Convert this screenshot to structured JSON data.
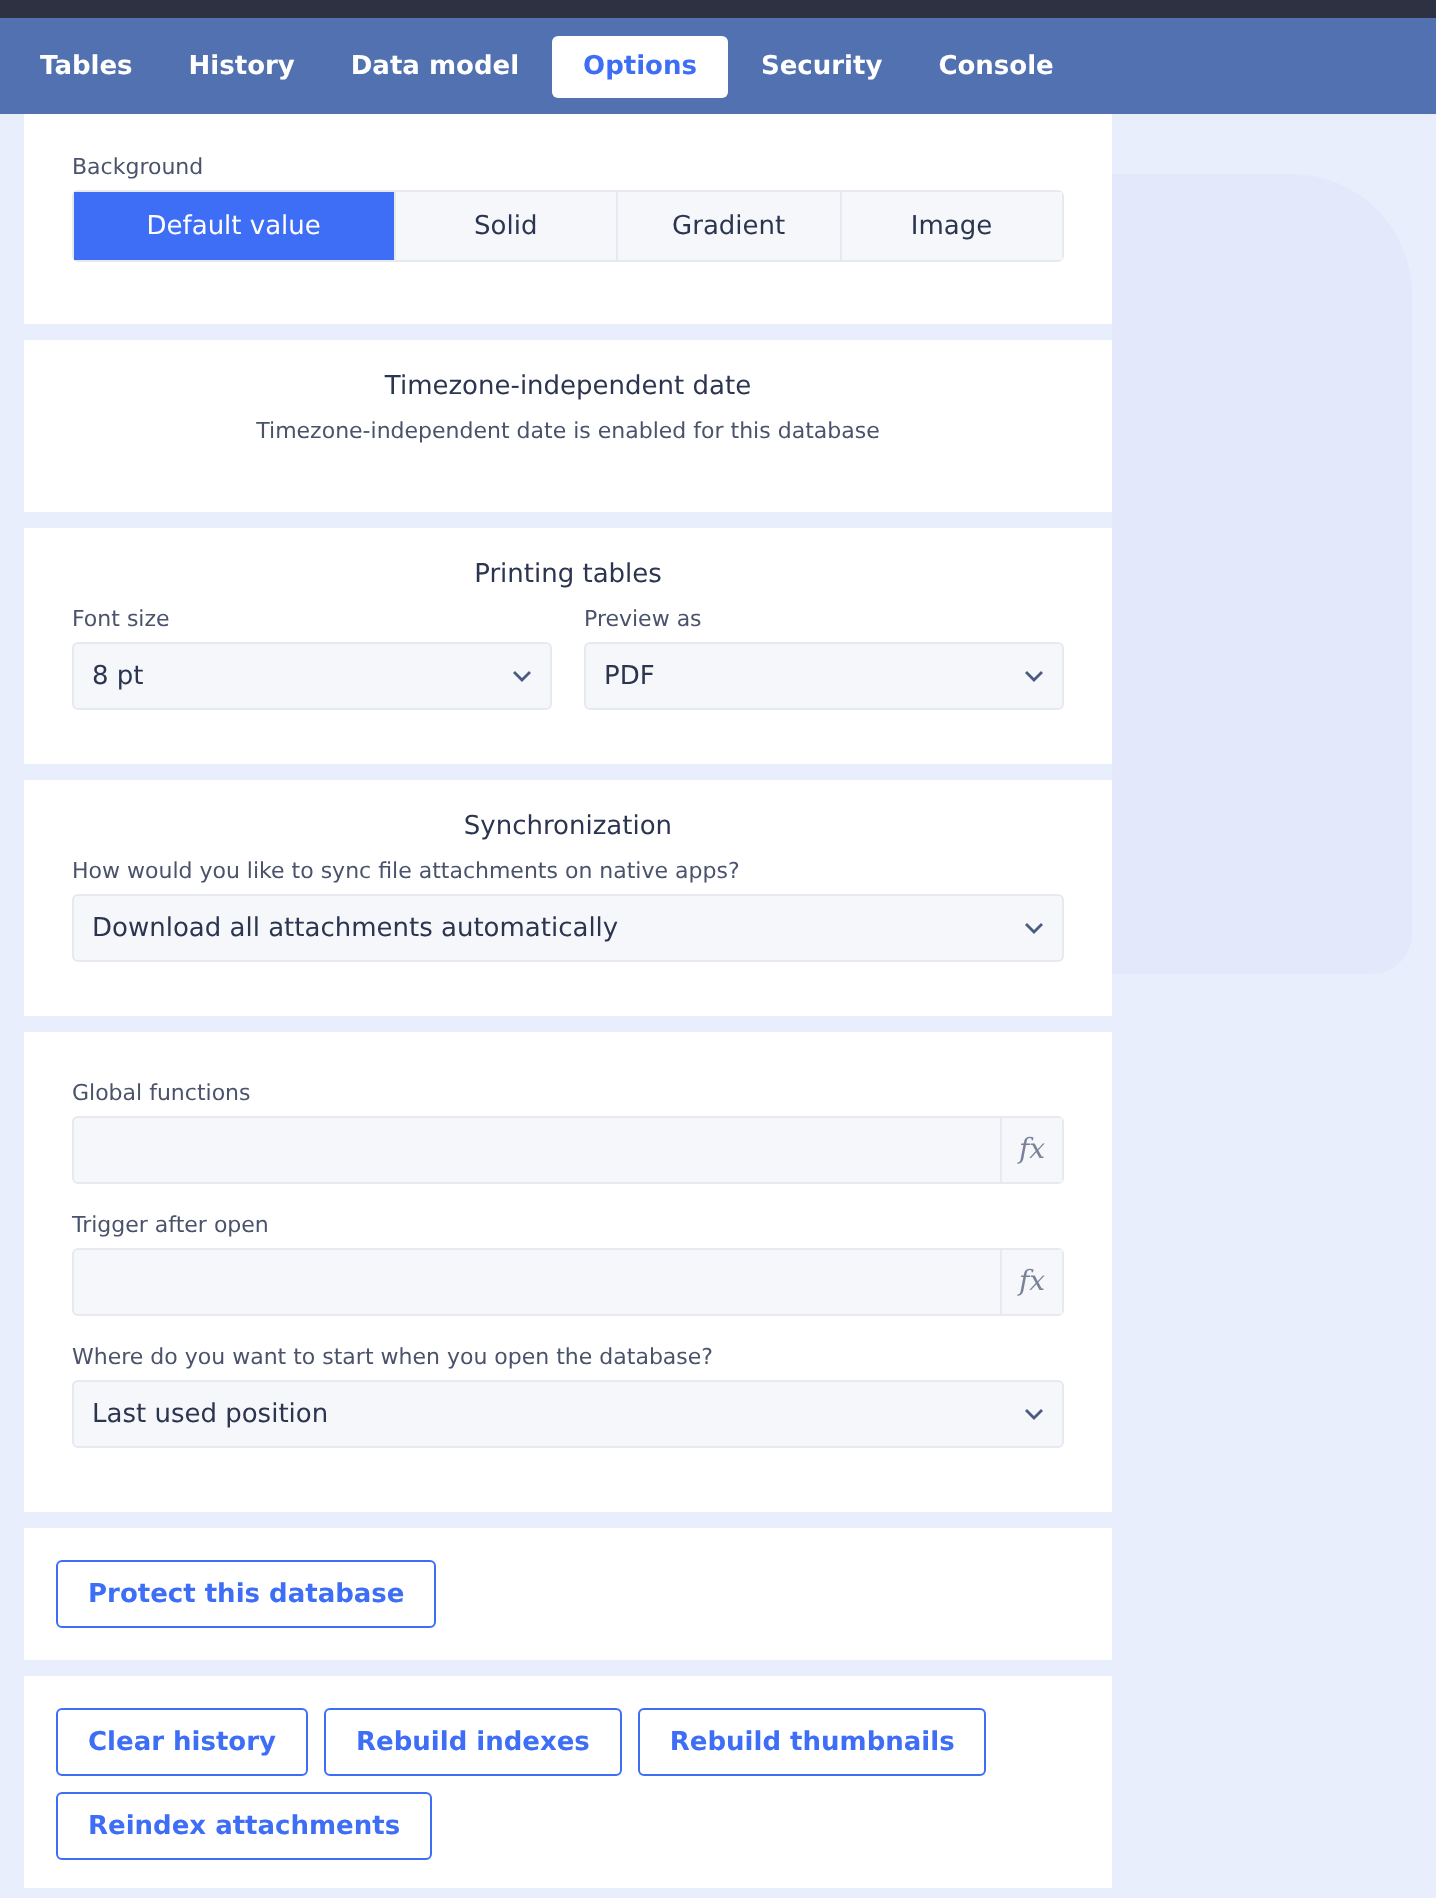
{
  "tabs": [
    {
      "label": "Tables",
      "selected": false
    },
    {
      "label": "History",
      "selected": false
    },
    {
      "label": "Data model",
      "selected": false
    },
    {
      "label": "Options",
      "selected": true
    },
    {
      "label": "Security",
      "selected": false
    },
    {
      "label": "Console",
      "selected": false
    }
  ],
  "background": {
    "label": "Background",
    "options": [
      {
        "label": "Default value",
        "selected": true
      },
      {
        "label": "Solid",
        "selected": false
      },
      {
        "label": "Gradient",
        "selected": false
      },
      {
        "label": "Image",
        "selected": false
      }
    ]
  },
  "timezone": {
    "title": "Timezone-independent date",
    "text": "Timezone-independent date is enabled for this database"
  },
  "printing": {
    "title": "Printing tables",
    "fields": [
      {
        "label": "Font size",
        "value": "8 pt"
      },
      {
        "label": "Preview as",
        "value": "PDF"
      }
    ]
  },
  "sync": {
    "title": "Synchronization",
    "label": "How would you like to sync file attachments on native apps?",
    "value": "Download all attachments automatically"
  },
  "scripts": {
    "fields": [
      {
        "kind": "formula",
        "label": "Global functions",
        "button": "fx"
      },
      {
        "kind": "formula",
        "label": "Trigger after open",
        "button": "fx"
      },
      {
        "kind": "select",
        "label": "Where do you want to start when you open the database?",
        "value": "Last used position"
      }
    ]
  },
  "protect": {
    "button": "Protect this database"
  },
  "maintenance": {
    "buttons": [
      "Clear history",
      "Rebuild indexes",
      "Rebuild thumbnails",
      "Reindex attachments"
    ]
  }
}
